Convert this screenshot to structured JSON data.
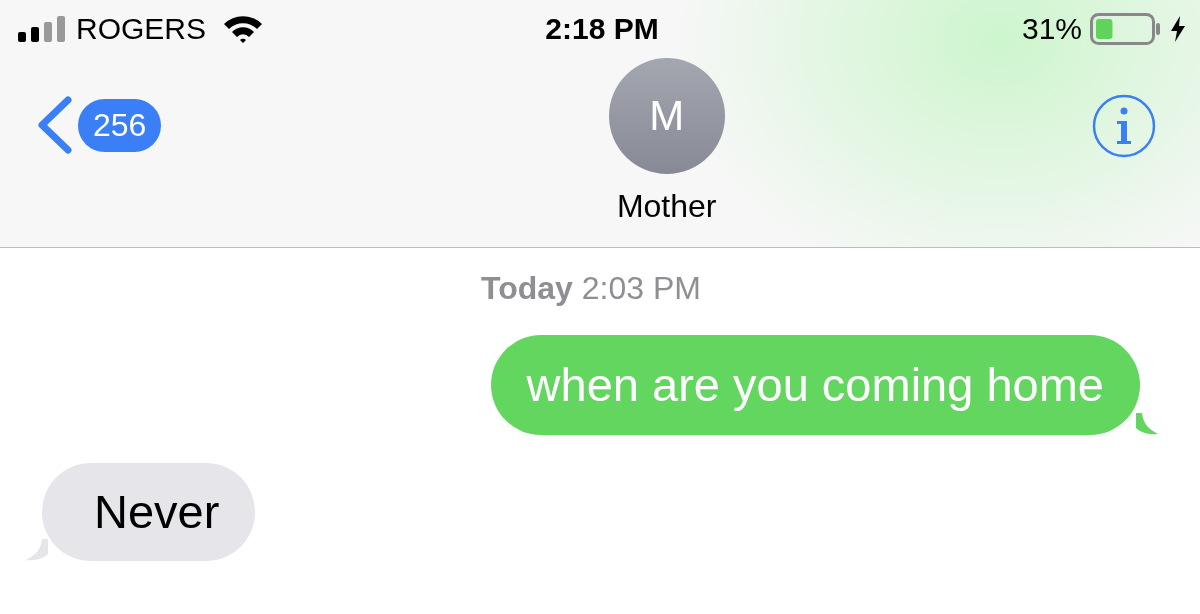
{
  "status_bar": {
    "carrier": "ROGERS",
    "time": "2:18 PM",
    "battery_percent": "31%",
    "battery": {
      "level": 0.31,
      "charging": true
    }
  },
  "header": {
    "back_count": "256",
    "avatar_initial": "M",
    "contact_name": "Mother"
  },
  "timestamp": "**Today** 2:03 PM",
  "messages": [
    {
      "kind": "sent",
      "text": "when are you coming home"
    },
    {
      "kind": "received",
      "text": "Never"
    }
  ]
}
